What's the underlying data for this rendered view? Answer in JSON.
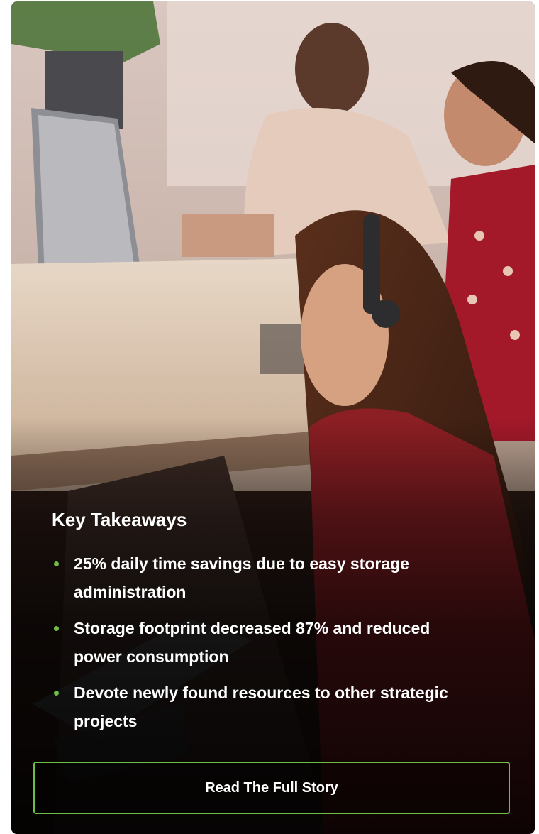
{
  "colors": {
    "accent": "#6fbf44",
    "text": "#ffffff",
    "overlay": "#000000"
  },
  "hero_image": {
    "icon": "office-photo",
    "description_hidden": true
  },
  "takeaways": {
    "title": "Key Takeaways",
    "items": [
      "25% daily time savings due to easy storage administration",
      "Storage footprint decreased 87% and reduced power consumption",
      "Devote newly found resources to other strategic projects"
    ]
  },
  "cta": {
    "label": "Read The Full Story"
  }
}
